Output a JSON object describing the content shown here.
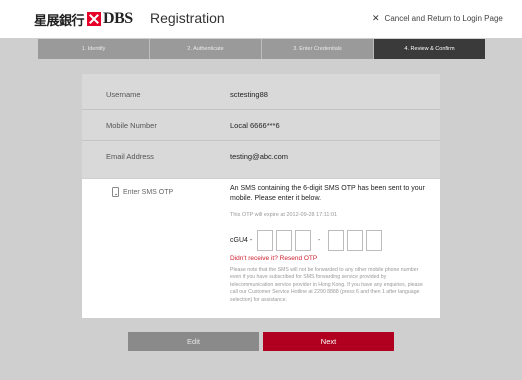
{
  "header": {
    "logo_cn": "星展銀行",
    "logo_en": "DBS",
    "page_title": "Registration",
    "cancel_label": "Cancel and Return to Login Page"
  },
  "steps": [
    {
      "label": "1. Identify",
      "active": false
    },
    {
      "label": "2. Authenticate",
      "active": false
    },
    {
      "label": "3. Enter Credentials",
      "active": false
    },
    {
      "label": "4. Review & Confirm",
      "active": true
    }
  ],
  "details": [
    {
      "label": "Username",
      "value": "sctesting88"
    },
    {
      "label": "Mobile Number",
      "value": "Local 6666***6"
    },
    {
      "label": "Email Address",
      "value": "testing@abc.com"
    }
  ],
  "otp": {
    "label": "Enter SMS OTP",
    "message": "An SMS containing the 6-digit SMS OTP has been sent to your mobile. Please enter it below.",
    "expire_text": "This OTP will expire at 2012-09-28 17:11:01",
    "prefix": "cGU4 -",
    "separator": "-",
    "resend": "Didn't receive it? Resend OTP",
    "note": "Please note that the SMS will not be forwarded to any other mobile phone number even if you have subscribed for SMS forwarding service provided by telecommunication service provider in Hong Kong. If you have any enquiries, please call our Customer Service Hotline at 2290 8888 (press 6 and then 1 after language selection) for assistance."
  },
  "buttons": {
    "edit": "Edit",
    "next": "Next"
  },
  "colors": {
    "brand_red": "#e60028",
    "next_button": "#b1001f",
    "step_active": "#3a3a3a",
    "step_inactive": "#9a9a9a"
  }
}
